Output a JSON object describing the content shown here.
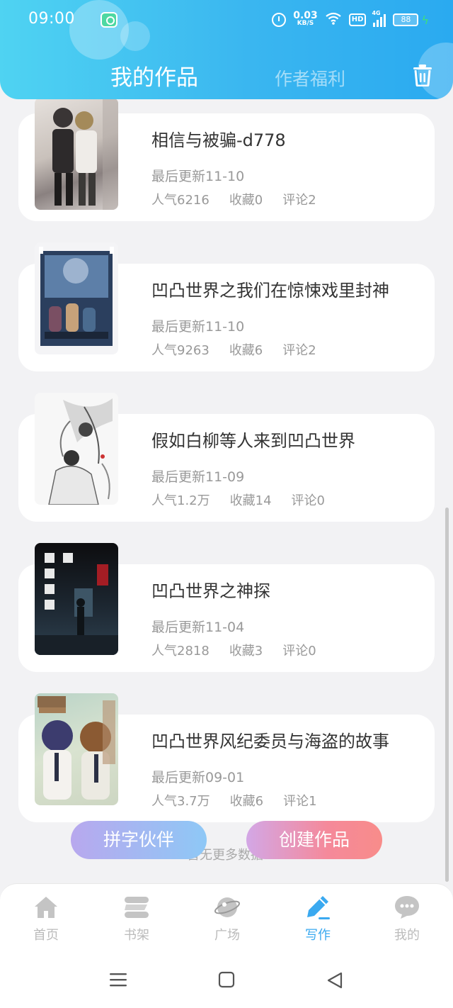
{
  "status_bar": {
    "time": "09:00",
    "net_speed": "0.03",
    "net_unit": "KB/S",
    "hd_label": "HD",
    "signal_label": "4G",
    "battery": "88"
  },
  "header": {
    "tab_works": "我的作品",
    "tab_welfare": "作者福利"
  },
  "works": [
    {
      "title": "相信与被骗-d778",
      "updated": "最后更新11-10",
      "popularity": "人气6216",
      "favorites": "收藏0",
      "comments": "评论2"
    },
    {
      "title": "凹凸世界之我们在惊悚戏里封神",
      "updated": "最后更新11-10",
      "popularity": "人气9263",
      "favorites": "收藏6",
      "comments": "评论2"
    },
    {
      "title": "假如白柳等人来到凹凸世界",
      "updated": "最后更新11-09",
      "popularity": "人气1.2万",
      "favorites": "收藏14",
      "comments": "评论0"
    },
    {
      "title": "凹凸世界之神探",
      "updated": "最后更新11-04",
      "popularity": "人气2818",
      "favorites": "收藏3",
      "comments": "评论0"
    },
    {
      "title": "凹凸世界风纪委员与海盗的故事",
      "updated": "最后更新09-01",
      "popularity": "人气3.7万",
      "favorites": "收藏6",
      "comments": "评论1"
    }
  ],
  "floating_buttons": {
    "pin_partner": "拼字伙伴",
    "create_work": "创建作品"
  },
  "no_more_text": "暂无更多数据",
  "bottom_nav": [
    {
      "label": "首页",
      "icon": "home-icon"
    },
    {
      "label": "书架",
      "icon": "bookshelf-icon"
    },
    {
      "label": "广场",
      "icon": "planet-icon"
    },
    {
      "label": "写作",
      "icon": "pen-icon"
    },
    {
      "label": "我的",
      "icon": "chat-bubble-icon"
    }
  ],
  "active_nav": "写作",
  "colors": {
    "header_start": "#4fd3f2",
    "header_end": "#2aaaf0",
    "accent": "#3aa9f0",
    "create_button": "#f5899a",
    "pin_button": "#8ec8f6"
  }
}
